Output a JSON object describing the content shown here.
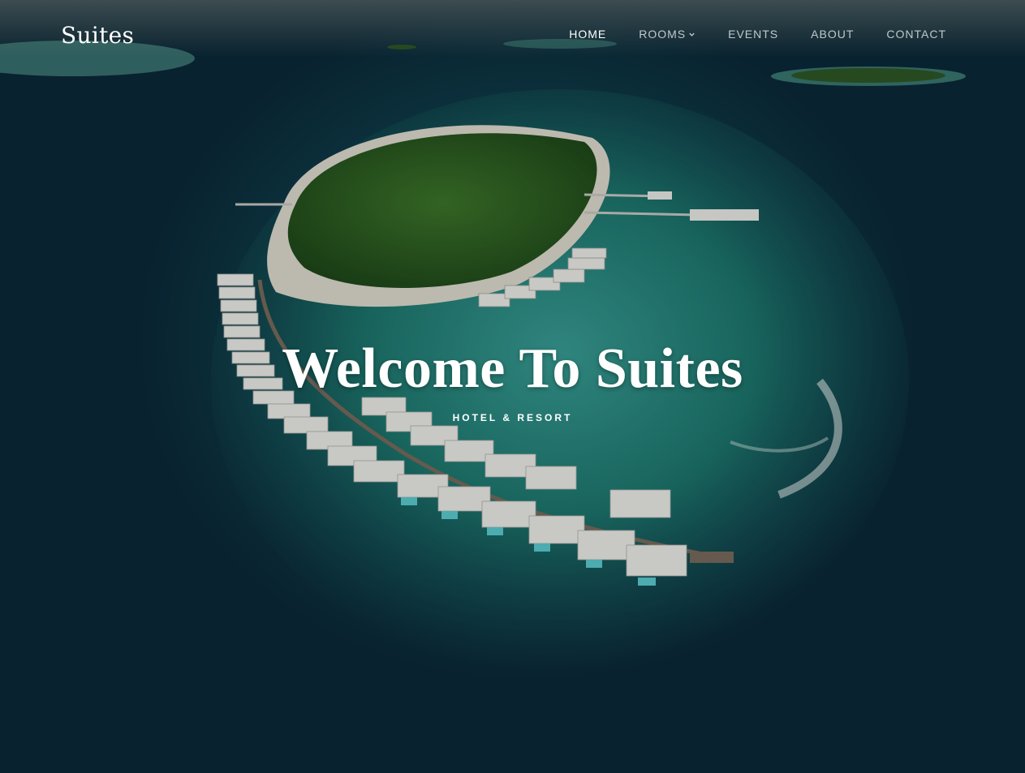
{
  "header": {
    "brand": "Suites",
    "nav": [
      {
        "label": "HOME",
        "active": true
      },
      {
        "label": "ROOMS",
        "has_dropdown": true
      },
      {
        "label": "EVENTS"
      },
      {
        "label": "ABOUT"
      },
      {
        "label": "CONTACT"
      }
    ]
  },
  "hero": {
    "title": "Welcome To Suites",
    "subtitle": "HOTEL & RESORT",
    "background": "aerial-island-resort-photo"
  },
  "colors": {
    "ocean_deep": "#0b2a3a",
    "lagoon": "#1d6f6a",
    "island_green": "#2f5d24",
    "sand": "#e6e2d6",
    "text": "#ffffff"
  }
}
